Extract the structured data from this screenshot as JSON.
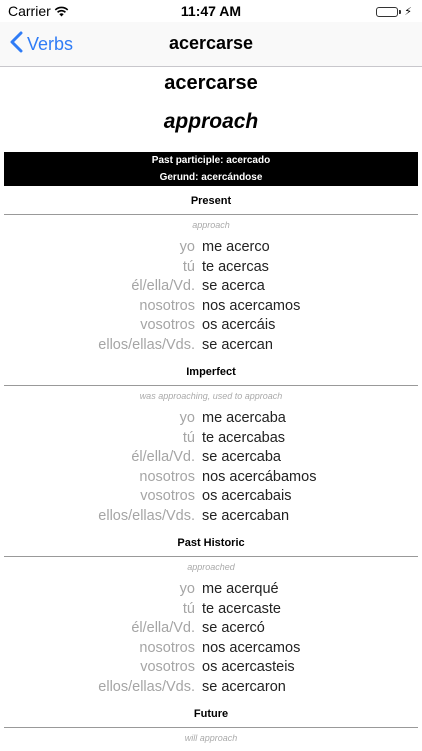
{
  "status_bar": {
    "carrier": "Carrier",
    "time": "11:47 AM",
    "battery_level": 1.0
  },
  "nav": {
    "back_label": "Verbs",
    "title": "acercarse"
  },
  "verb": {
    "infinitive": "acercarse",
    "translation": "approach"
  },
  "forms": {
    "past_participle": "Past participle: acercado",
    "gerund": "Gerund: acercándose"
  },
  "tenses": [
    {
      "name": "Present",
      "meaning": "approach",
      "rows": [
        {
          "pronoun": "yo",
          "form": "me acerco"
        },
        {
          "pronoun": "tú",
          "form": "te acercas"
        },
        {
          "pronoun": "él/ella/Vd.",
          "form": "se acerca"
        },
        {
          "pronoun": "nosotros",
          "form": "nos acercamos"
        },
        {
          "pronoun": "vosotros",
          "form": "os acercáis"
        },
        {
          "pronoun": "ellos/ellas/Vds.",
          "form": "se acercan"
        }
      ]
    },
    {
      "name": "Imperfect",
      "meaning": "was approaching, used to approach",
      "rows": [
        {
          "pronoun": "yo",
          "form": "me acercaba"
        },
        {
          "pronoun": "tú",
          "form": "te acercabas"
        },
        {
          "pronoun": "él/ella/Vd.",
          "form": "se acercaba"
        },
        {
          "pronoun": "nosotros",
          "form": "nos acercábamos"
        },
        {
          "pronoun": "vosotros",
          "form": "os acercabais"
        },
        {
          "pronoun": "ellos/ellas/Vds.",
          "form": "se acercaban"
        }
      ]
    },
    {
      "name": "Past Historic",
      "meaning": "approached",
      "rows": [
        {
          "pronoun": "yo",
          "form": "me acerqué"
        },
        {
          "pronoun": "tú",
          "form": "te acercaste"
        },
        {
          "pronoun": "él/ella/Vd.",
          "form": "se acercó"
        },
        {
          "pronoun": "nosotros",
          "form": "nos acercamos"
        },
        {
          "pronoun": "vosotros",
          "form": "os acercasteis"
        },
        {
          "pronoun": "ellos/ellas/Vds.",
          "form": "se acercaron"
        }
      ]
    },
    {
      "name": "Future",
      "meaning": "will approach",
      "rows": []
    }
  ]
}
